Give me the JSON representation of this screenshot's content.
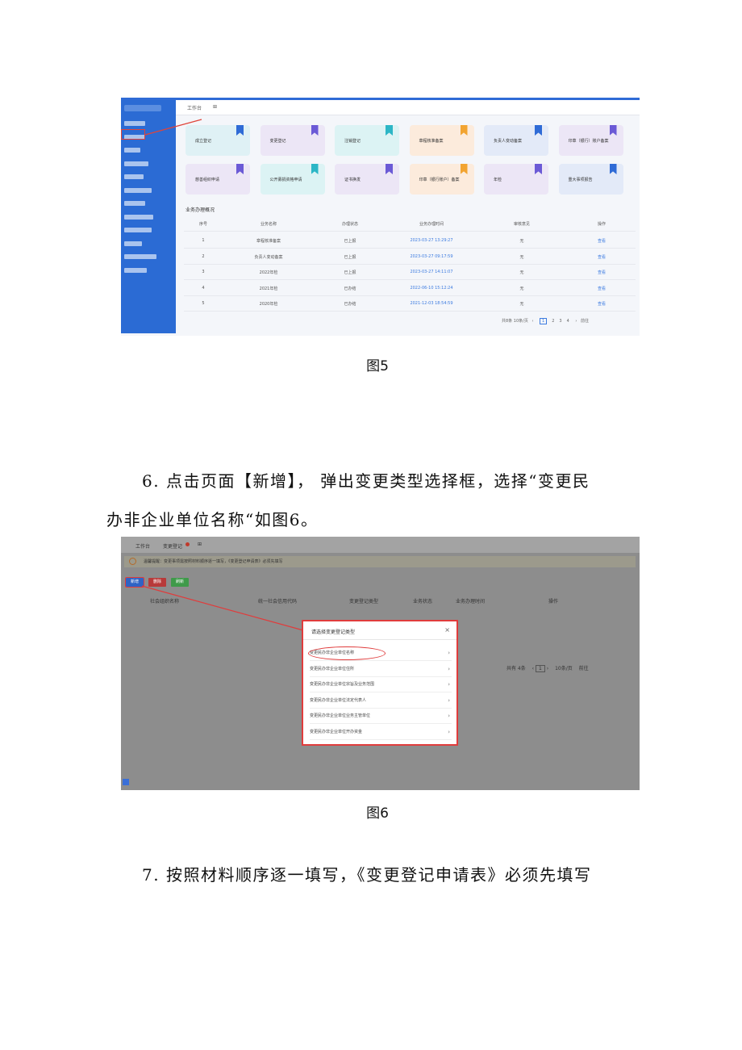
{
  "figure5": {
    "sidebar_items": [
      "核名登记",
      "变更登记",
      "注销登记",
      "章程核准备案",
      "负责人备案",
      "印章（银行）备案",
      "年度报告",
      "公开募捐资格申请",
      "公开募捐方案备案",
      "证书换发",
      "印章（银行账户）备案",
      "重大事项报告"
    ],
    "tab_label": "工作台",
    "cards": [
      {
        "label": "成立登记",
        "bg": "#dff1f5",
        "bookmark": "#2f6bd6"
      },
      {
        "label": "变更登记",
        "bg": "#ece6f6",
        "bookmark": "#6b5ad6"
      },
      {
        "label": "注销登记",
        "bg": "#dcf3f4",
        "bookmark": "#2cb6c6"
      },
      {
        "label": "章程核准备案",
        "bg": "#fcebdc",
        "bookmark": "#f2a431"
      },
      {
        "label": "负责人变动备案",
        "bg": "#e3eaf8",
        "bookmark": "#2f6bd6"
      },
      {
        "label": "印章（银行）账户备案",
        "bg": "#ece6f6",
        "bookmark": "#6b5ad6"
      },
      {
        "label": "慈善组织申请",
        "bg": "#ece6f6",
        "bookmark": "#6b5ad6"
      },
      {
        "label": "公开募捐资格申请",
        "bg": "#dcf3f4",
        "bookmark": "#2cb6c6"
      },
      {
        "label": "证书换发",
        "bg": "#ece6f6",
        "bookmark": "#6b5ad6"
      },
      {
        "label": "印章（银行账户）备案",
        "bg": "#fcebdc",
        "bookmark": "#f2a431"
      },
      {
        "label": "年检",
        "bg": "#ece6f6",
        "bookmark": "#6b5ad6"
      },
      {
        "label": "重大事项报告",
        "bg": "#e3eaf8",
        "bookmark": "#2f6bd6"
      }
    ],
    "section_title": "业务办理概况",
    "table_headers": [
      "序号",
      "业务名称",
      "办理状态",
      "业务办理时间",
      "审核意见",
      "操作"
    ],
    "table_rows": [
      [
        "1",
        "章程核准备案",
        "已上报",
        "2023-03-27 13:29:27",
        "无",
        "查看"
      ],
      [
        "2",
        "负责人变动备案",
        "已上报",
        "2023-03-27 09:17:59",
        "无",
        "查看"
      ],
      [
        "3",
        "2022年检",
        "已上报",
        "2023-03-27 14:11:07",
        "无",
        "查看"
      ],
      [
        "4",
        "2021年检",
        "已办结",
        "2022-06-10 15:12:24",
        "无",
        "查看"
      ],
      [
        "5",
        "2020年检",
        "已办结",
        "2021-12-03 18:54:59",
        "无",
        "查看"
      ]
    ],
    "pager": {
      "total": "共8条",
      "per_page": "10条/页",
      "pages": [
        "1",
        "2",
        "3",
        "4"
      ],
      "goto": "前往"
    }
  },
  "caption5": "图5",
  "paragraph6_line1": "6. 点击页面【新增】，    弹出变更类型选择框，选择“变更民",
  "paragraph6_line2": "办非企业单位名称“如图6。",
  "figure6": {
    "tabs": [
      "工作台",
      "变更登记"
    ],
    "notice": "温馨提醒：变更事项需按照材料顺序逐一填写，《变更登记申请表》必须先填写",
    "buttons": [
      {
        "label": "新增",
        "color": "#2f63c4"
      },
      {
        "label": "删除",
        "color": "#b83a3a"
      },
      {
        "label": "刷新",
        "color": "#3f9a4a"
      }
    ],
    "table_headers": [
      "社会组织名称",
      "统一社会信用代码",
      "变更登记类型",
      "业务状态",
      "业务办理时间",
      "操作"
    ],
    "dialog_title": "请选择变更登记类型",
    "dialog_close": "×",
    "dialog_options": [
      "变更民办非企业单位名称",
      "变更民办非企业单位住所",
      "变更民办非企业单位宗旨及业务范围",
      "变更民办非企业单位法定代表人",
      "变更民办非企业单位业务主管单位",
      "变更民办非企业单位开办资金"
    ],
    "pager": {
      "total": "共有 4条",
      "page": "1",
      "per_page": "10条/页",
      "goto": "前往"
    }
  },
  "caption6": "图6",
  "paragraph7": "7. 按照材料顺序逐一填写，《变更登记申请表》必须先填写"
}
